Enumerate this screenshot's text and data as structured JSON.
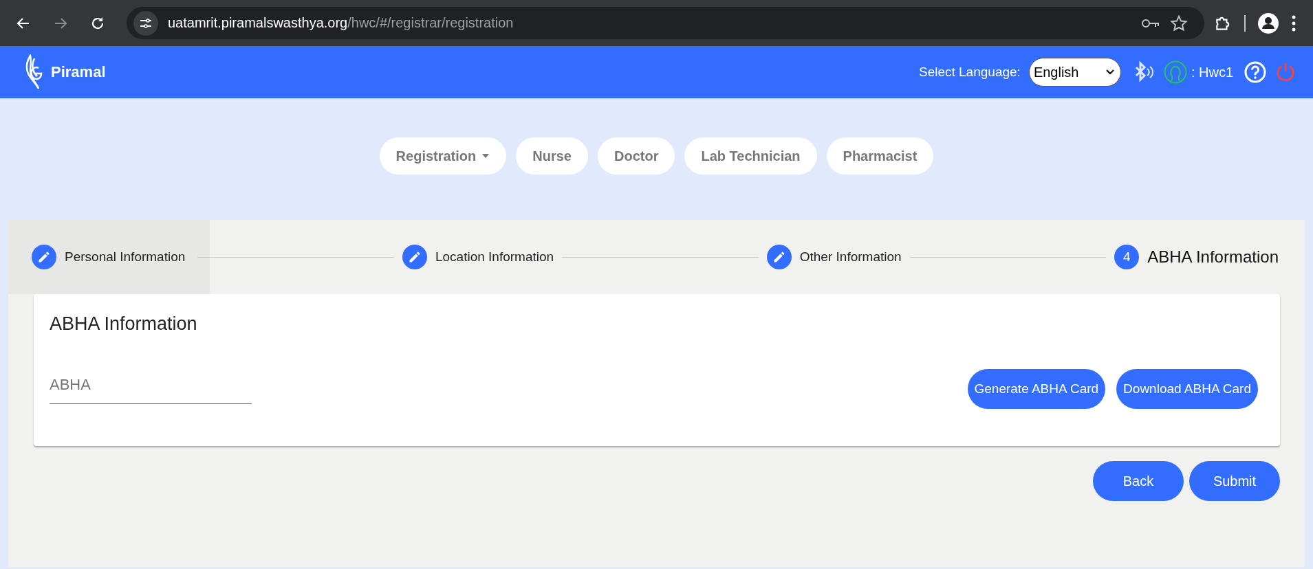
{
  "browser": {
    "url_host": "uatamrit.piramalswasthya.org",
    "url_path": "/hwc/#/registrar/registration"
  },
  "header": {
    "brand": "Piramal",
    "language_label": "Select Language:",
    "language_value": "English",
    "user": ": Hwc1"
  },
  "nav": [
    {
      "label": "Registration",
      "dropdown": true
    },
    {
      "label": "Nurse",
      "dropdown": false
    },
    {
      "label": "Doctor",
      "dropdown": false
    },
    {
      "label": "Lab Technician",
      "dropdown": false
    },
    {
      "label": "Pharmacist",
      "dropdown": false
    }
  ],
  "steps": [
    {
      "kind": "edit",
      "label": "Personal Information",
      "selected": false,
      "focused": true
    },
    {
      "kind": "edit",
      "label": "Location Information",
      "selected": false,
      "focused": false
    },
    {
      "kind": "edit",
      "label": "Other Information",
      "selected": false,
      "focused": false
    },
    {
      "kind": "number",
      "number": "4",
      "label": "ABHA Information",
      "selected": true,
      "focused": false
    }
  ],
  "card": {
    "title": "ABHA Information",
    "field": {
      "placeholder": "ABHA"
    },
    "buttons": [
      "Generate ABHA Card",
      "Download ABHA Card"
    ]
  },
  "actions": [
    "Back",
    "Submit"
  ]
}
